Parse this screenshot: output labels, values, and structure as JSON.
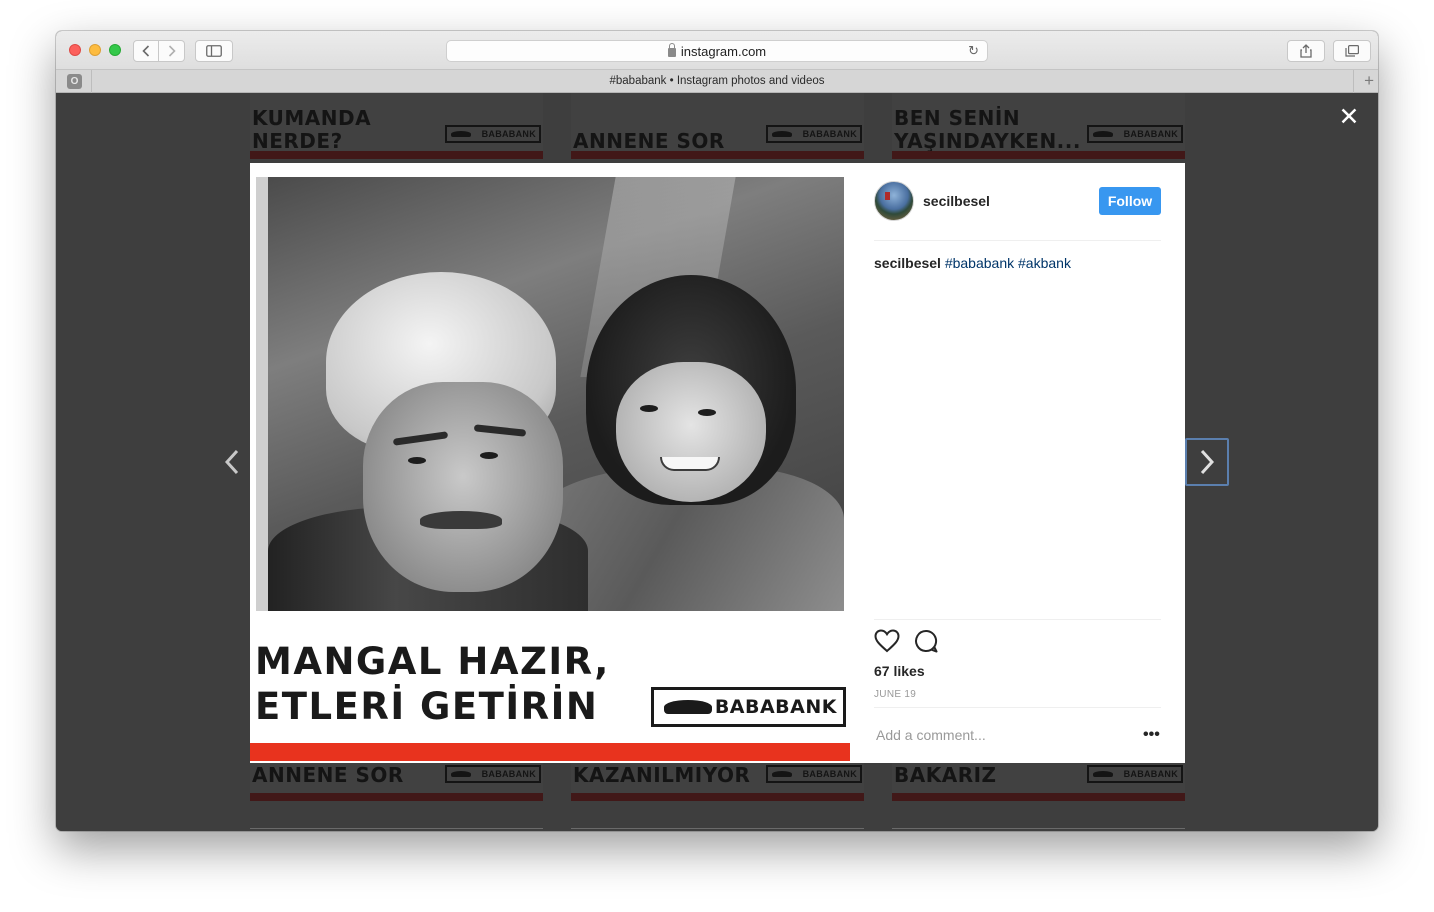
{
  "browser": {
    "url": "instagram.com",
    "tab_title": "#bababank • Instagram photos and videos",
    "tab_favicon": "O"
  },
  "grid": {
    "top_row": [
      {
        "title_line1": "KUMANDA",
        "title_line2": "NERDE?",
        "logo": "BABABANK"
      },
      {
        "title_line1": "",
        "title_line2": "ANNENE SOR",
        "logo": "BABABANK"
      },
      {
        "title_line1": "BEN SENİN",
        "title_line2": "YAŞINDAYKEN...",
        "logo": "BABABANK"
      }
    ],
    "bottom_row": [
      {
        "title": "ANNENE SOR",
        "logo": "BABABANK"
      },
      {
        "title": "KAZANILMIYOR",
        "logo": "BABABANK"
      },
      {
        "title": "BAKARIZ",
        "logo": "BABABANK"
      }
    ]
  },
  "modal": {
    "close_icon": "close-icon",
    "photo": {
      "caption_line1": "MANGAL HAZIR,",
      "caption_line2": "ETLERİ GETİRİN",
      "logo": "BABABANK",
      "stripe_color": "#e8331e"
    },
    "post": {
      "username": "secilbesel",
      "follow_label": "Follow",
      "caption_user": "secilbesel",
      "hashtags": [
        "#bababank",
        "#akbank"
      ],
      "likes": "67 likes",
      "date": "JUNE 19",
      "comment_placeholder": "Add a comment...",
      "more_label": "•••",
      "accent_color": "#3897f0"
    }
  }
}
